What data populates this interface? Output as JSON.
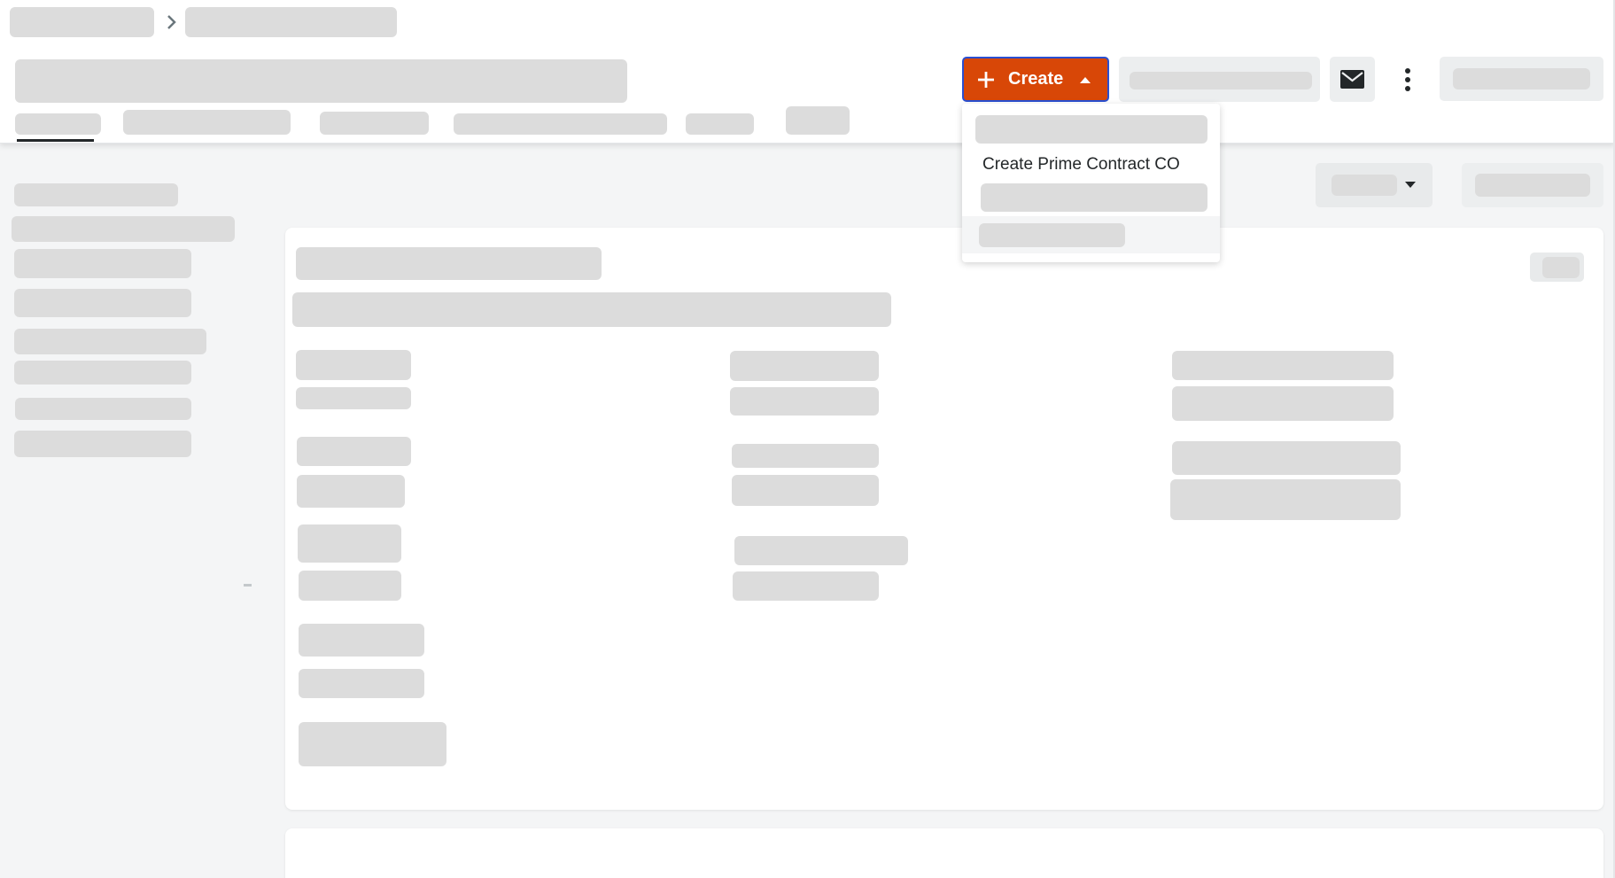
{
  "header": {
    "create_button": {
      "label": "Create",
      "plus_icon": "plus-icon",
      "caret_icon": "caret-up-icon",
      "color": "#d84707",
      "focus_border": "#2a4fd1"
    },
    "email_icon": "envelope-icon",
    "more_icon": "kebab-vertical-icon",
    "breadcrumb_separator_icon": "chevron-right-icon"
  },
  "create_menu": {
    "items": [
      {
        "label": ""
      },
      {
        "label": "Create Prime Contract CO"
      },
      {
        "label": ""
      },
      {
        "label": ""
      }
    ]
  },
  "toolbar": {
    "filter_caret_icon": "caret-down-icon"
  }
}
